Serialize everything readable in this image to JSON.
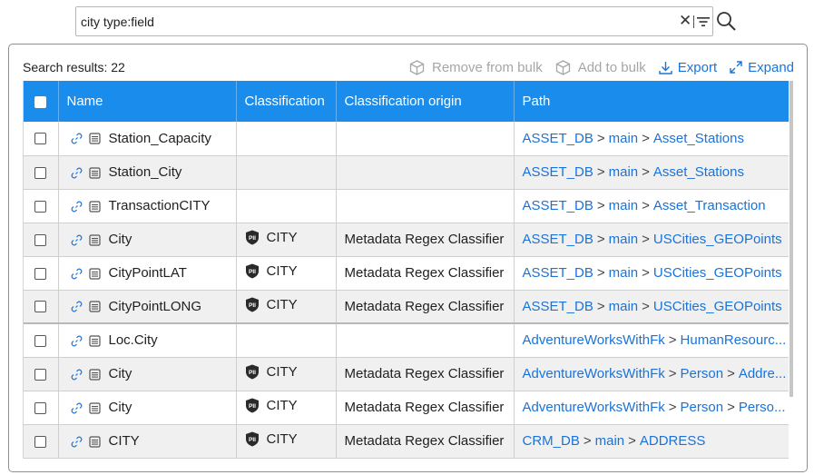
{
  "search": {
    "query": "city type:field"
  },
  "results": {
    "label": "Search results: 22"
  },
  "toolbar": {
    "remove_bulk": "Remove from bulk",
    "add_bulk": "Add to bulk",
    "export": "Export",
    "expand": "Expand"
  },
  "columns": [
    "Name",
    "Classification",
    "Classification origin",
    "Path"
  ],
  "rows": [
    {
      "name": "Station_Capacity",
      "classification": "",
      "origin": "",
      "path": [
        "ASSET_DB",
        "main",
        "Asset_Stations"
      ]
    },
    {
      "name": "Station_City",
      "classification": "",
      "origin": "",
      "path": [
        "ASSET_DB",
        "main",
        "Asset_Stations"
      ]
    },
    {
      "name": "TransactionCITY",
      "classification": "",
      "origin": "",
      "path": [
        "ASSET_DB",
        "main",
        "Asset_Transaction"
      ]
    },
    {
      "name": "City",
      "classification": "CITY",
      "origin": "Metadata Regex Classifier",
      "path": [
        "ASSET_DB",
        "main",
        "USCities_GEOPoints"
      ]
    },
    {
      "name": "CityPointLAT",
      "classification": "CITY",
      "origin": "Metadata Regex Classifier",
      "path": [
        "ASSET_DB",
        "main",
        "USCities_GEOPoints"
      ]
    },
    {
      "name": "CityPointLONG",
      "classification": "CITY",
      "origin": "Metadata Regex Classifier",
      "path": [
        "ASSET_DB",
        "main",
        "USCities_GEOPoints"
      ]
    },
    {
      "name": "Loc.City",
      "classification": "",
      "origin": "",
      "path": [
        "AdventureWorksWithFk",
        "HumanResourc..."
      ]
    },
    {
      "name": "City",
      "classification": "CITY",
      "origin": "Metadata Regex Classifier",
      "path": [
        "AdventureWorksWithFk",
        "Person",
        "Addre..."
      ]
    },
    {
      "name": "City",
      "classification": "CITY",
      "origin": "Metadata Regex Classifier",
      "path": [
        "AdventureWorksWithFk",
        "Person",
        "Perso..."
      ]
    },
    {
      "name": "CITY",
      "classification": "CITY",
      "origin": "Metadata Regex Classifier",
      "path": [
        "CRM_DB",
        "main",
        "ADDRESS"
      ]
    }
  ],
  "icons": {
    "clear": "close-icon",
    "filter": "filter-icon",
    "search": "search-icon",
    "row_link": "link-icon",
    "row_doc": "field-icon",
    "classification": "pii-shield-icon"
  },
  "colors": {
    "header_bg": "#1a8ceb",
    "link": "#1a73d9",
    "disabled": "#a6a6a6"
  }
}
